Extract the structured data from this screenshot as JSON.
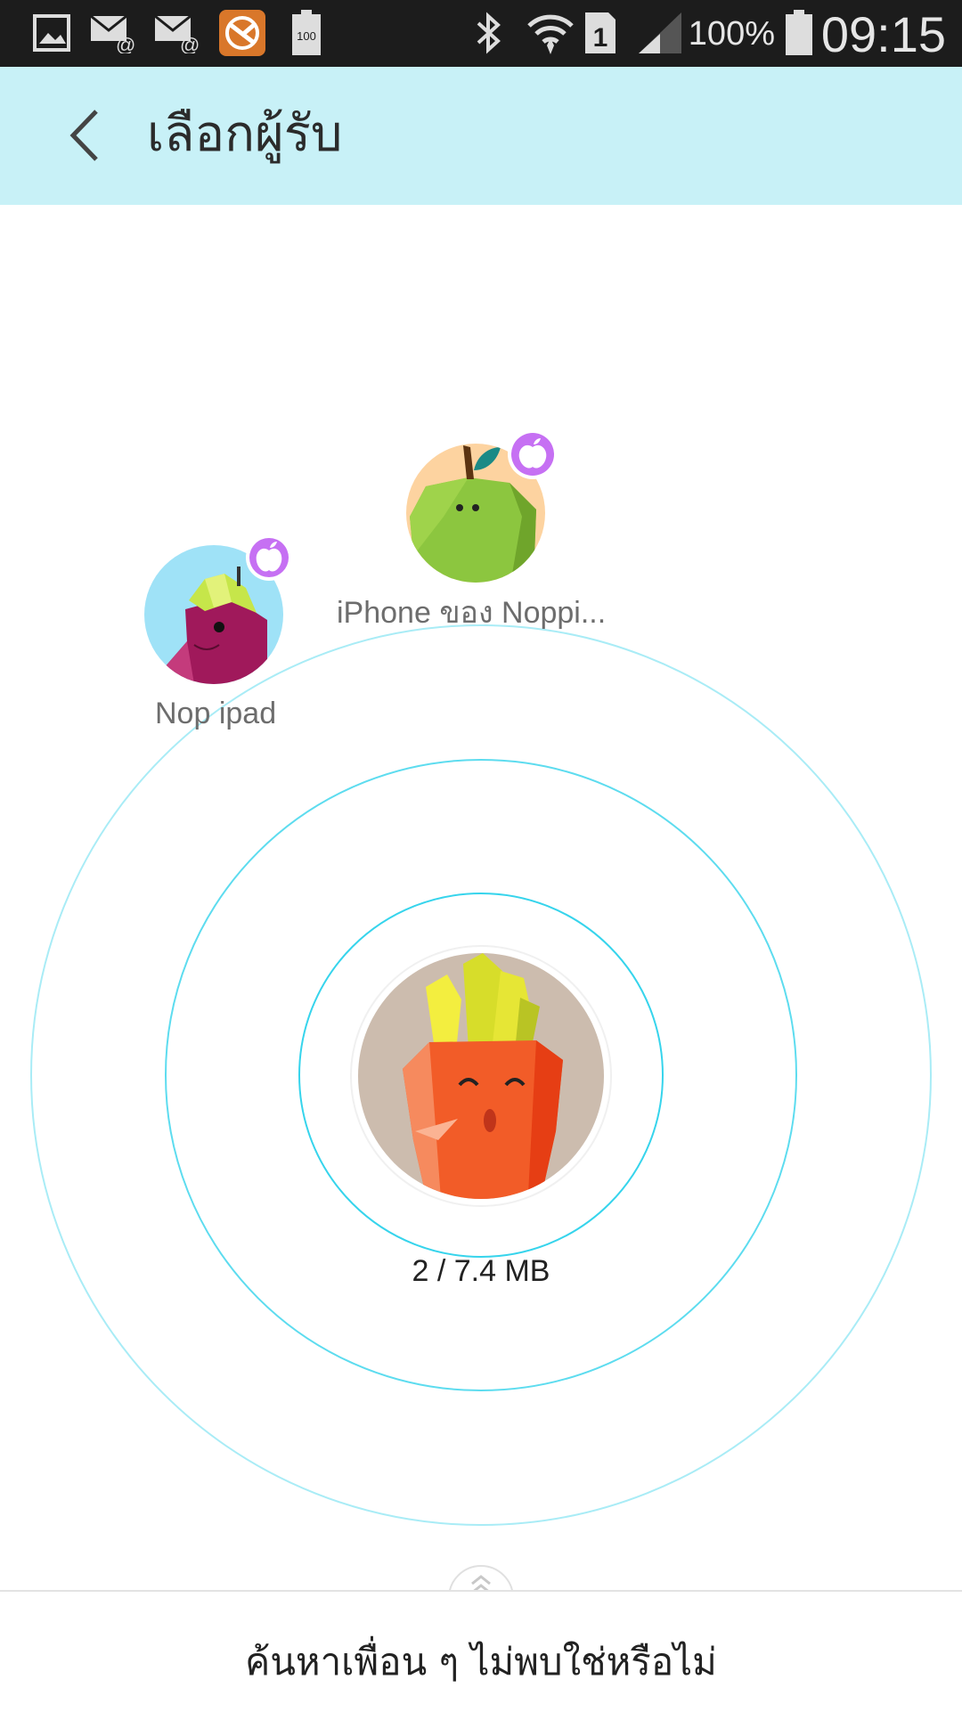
{
  "status_bar": {
    "left_icons": [
      "gallery-icon",
      "email-icon",
      "email-icon",
      "app-notification-icon",
      "battery-100-icon"
    ],
    "right_icons": [
      "bluetooth-icon",
      "wifi-icon",
      "sim-1-icon",
      "signal-icon",
      "battery-icon"
    ],
    "battery_percent": "100%",
    "time": "09:15"
  },
  "app_bar": {
    "title": "เลือกผู้รับ",
    "background": "#c8f1f7"
  },
  "radar": {
    "ring_color": "#36d4ec",
    "self": {
      "avatar": "carrot-avatar",
      "size_label": "2 / 7.4 MB"
    },
    "peers": [
      {
        "name": "Nop ipad",
        "avatar": "eggplant-avatar",
        "platform": "apple"
      },
      {
        "name": "iPhone ของ Noppi...",
        "avatar": "apple-avatar",
        "platform": "apple"
      }
    ]
  },
  "bottom": {
    "prompt": "ค้นหาเพื่อน ๆ ไม่พบใช่หรือไม่"
  }
}
